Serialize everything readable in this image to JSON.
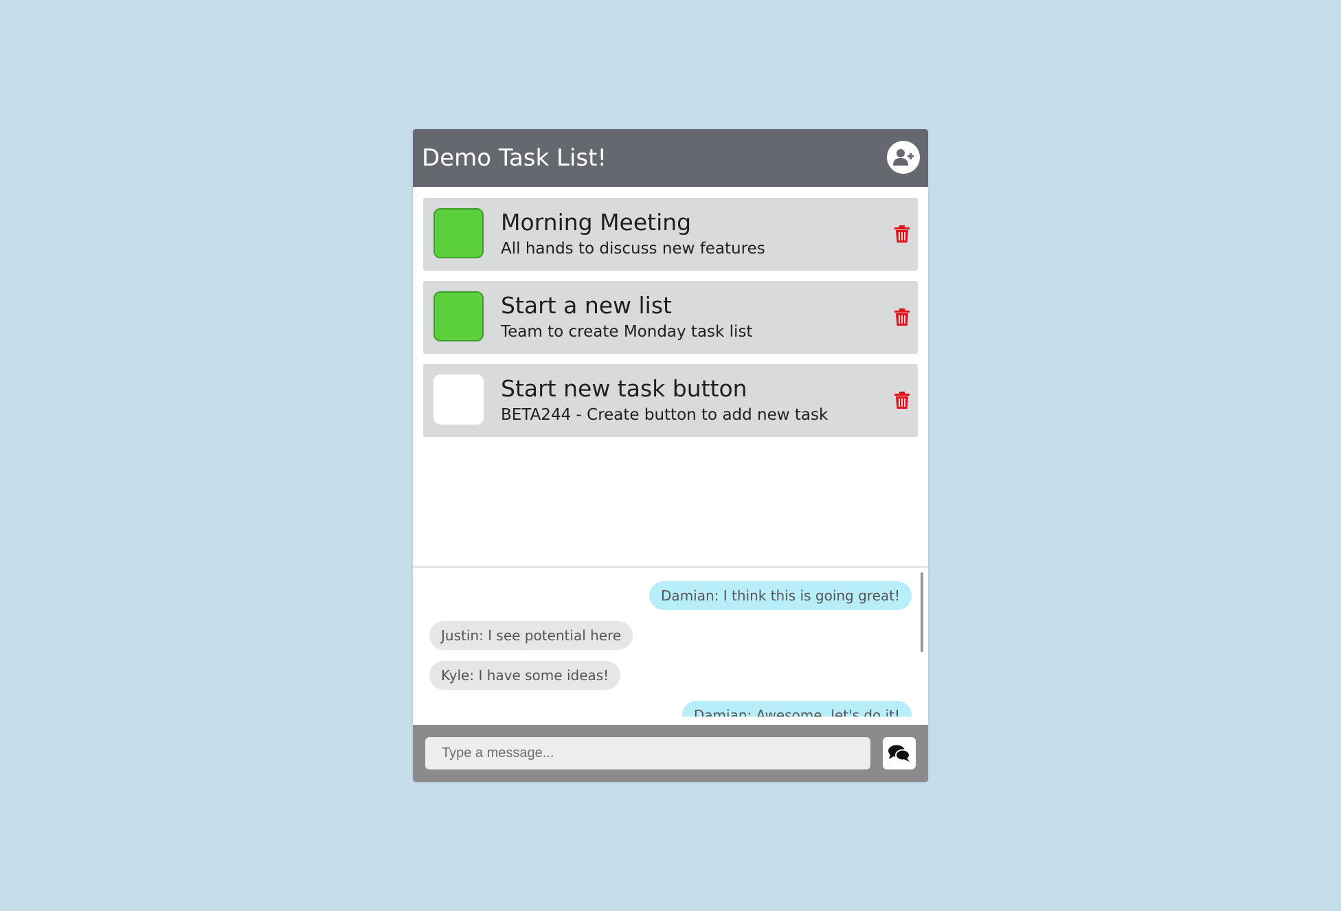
{
  "header": {
    "title": "Demo Task List!",
    "add_user_icon": "user-plus-icon"
  },
  "tasks": [
    {
      "title": "Morning Meeting",
      "description": "All hands to discuss new features",
      "completed": true
    },
    {
      "title": "Start a new list",
      "description": "Team to create Monday task list",
      "completed": true
    },
    {
      "title": "Start new task button",
      "description": "BETA244 - Create button to add new task",
      "completed": false
    }
  ],
  "chat": {
    "messages": [
      {
        "text": "Damian: I think this is going great!",
        "own": true
      },
      {
        "text": "Justin: I see potential here",
        "own": false
      },
      {
        "text": "Kyle: I have some ideas!",
        "own": false
      },
      {
        "text": "Damian: Awesome, let's do it!",
        "own": true
      }
    ],
    "input_placeholder": "Type a message...",
    "send_icon": "comments-icon"
  },
  "colors": {
    "background": "#c5dce9",
    "header": "#66686f",
    "task_card": "#d9dadc",
    "check_done": "#5ccf3d",
    "trash": "#e0111a",
    "own_bubble": "#b8eef9",
    "other_bubble": "#e6e6e6",
    "footer": "#8b8b8d"
  }
}
